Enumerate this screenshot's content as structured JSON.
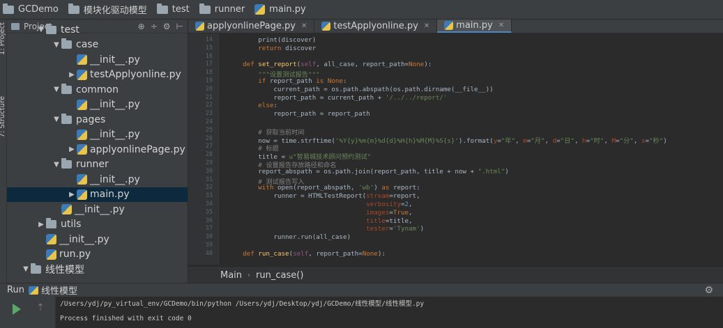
{
  "breadcrumb": [
    {
      "label": "GCDemo",
      "icon": "folder-icon"
    },
    {
      "label": "模块化驱动模型",
      "icon": "folder-icon"
    },
    {
      "label": "test",
      "icon": "folder-icon"
    },
    {
      "label": "runner",
      "icon": "folder-icon"
    },
    {
      "label": "main.py",
      "icon": "python-file-icon"
    }
  ],
  "side_strip": {
    "project": "1: Project",
    "structure": "7: Structure"
  },
  "project": {
    "title": "Project",
    "tools": [
      "⊕",
      "÷",
      "⚙",
      "⊢"
    ],
    "tree": [
      {
        "label": "test",
        "type": "folder",
        "arrow": "▼",
        "indent": 0
      },
      {
        "label": "case",
        "type": "folder",
        "arrow": "▼",
        "indent": 1
      },
      {
        "label": "__init__.py",
        "type": "py",
        "arrow": "",
        "indent": 2
      },
      {
        "label": "testApplyonline.py",
        "type": "py",
        "arrow": "▶",
        "indent": 2
      },
      {
        "label": "common",
        "type": "folder",
        "arrow": "▼",
        "indent": 1
      },
      {
        "label": "__init__.py",
        "type": "py",
        "arrow": "",
        "indent": 2
      },
      {
        "label": "pages",
        "type": "folder",
        "arrow": "▼",
        "indent": 1
      },
      {
        "label": "__init__.py",
        "type": "py",
        "arrow": "",
        "indent": 2
      },
      {
        "label": "applyonlinePage.py",
        "type": "py",
        "arrow": "▶",
        "indent": 2
      },
      {
        "label": "runner",
        "type": "folder",
        "arrow": "▼",
        "indent": 1
      },
      {
        "label": "__init__.py",
        "type": "py",
        "arrow": "",
        "indent": 2
      },
      {
        "label": "main.py",
        "type": "py",
        "arrow": "▶",
        "indent": 2,
        "selected": true
      },
      {
        "label": "__init__.py",
        "type": "py",
        "arrow": "",
        "indent": 1
      },
      {
        "label": "utils",
        "type": "folder",
        "arrow": "▶",
        "indent": 0
      },
      {
        "label": "__init__.py",
        "type": "py",
        "arrow": "",
        "indent": 0
      },
      {
        "label": "run.py",
        "type": "py",
        "arrow": "",
        "indent": 0
      },
      {
        "label": "线性模型",
        "type": "folder",
        "arrow": "▼",
        "indent": -1
      }
    ]
  },
  "tabs": [
    {
      "label": "applyonlinePage.py",
      "active": false
    },
    {
      "label": "testApplyonline.py",
      "active": false
    },
    {
      "label": "main.py",
      "active": true
    }
  ],
  "editor": {
    "lines": [
      {
        "n": "14",
        "html": "        print(discover)"
      },
      {
        "n": "15",
        "html": "        <span class='kw'>return</span> discover"
      },
      {
        "n": "16",
        "html": ""
      },
      {
        "n": "17",
        "html": "    <span class='kw'>def</span> <span class='fn'>set_report</span>(<span class='slf'>self</span>, all_case, report_path=<span class='kw'>None</span>):"
      },
      {
        "n": "18",
        "html": "        <span class='str'>\"\"\"设置测试报告\"\"\"</span>"
      },
      {
        "n": "19",
        "html": "        <span class='kw'>if</span> report_path <span class='kw'>is None</span>:"
      },
      {
        "n": "20",
        "html": "            current_path = os.path.abspath(os.path.dirname(__file__))"
      },
      {
        "n": "21",
        "html": "            report_path = current_path + <span class='str'>'/../../report/'</span>"
      },
      {
        "n": "22",
        "html": "        <span class='kw'>else</span>:"
      },
      {
        "n": "23",
        "html": "            report_path = report_path"
      },
      {
        "n": "24",
        "html": ""
      },
      {
        "n": "25",
        "html": "        <span class='cm'># 获取当前时间</span>"
      },
      {
        "n": "26",
        "html": "        now = time.strftime(<span class='str'>'%Y{y}%m{m}%d{d}%H{h}%M{M}%S{s}'</span>).format(<span class='prm'>y</span>=<span class='str'>\"年\"</span>, <span class='prm'>m</span>=<span class='str'>\"月\"</span>, <span class='prm'>d</span>=<span class='str'>\"日\"</span>, <span class='prm'>h</span>=<span class='str'>\"时\"</span>, <span class='prm'>M</span>=<span class='str'>\"分\"</span>, <span class='prm'>s</span>=<span class='str'>\"秒\"</span>)"
      },
      {
        "n": "27",
        "html": "        <span class='cm'># 标题</span>"
      },
      {
        "n": "28",
        "html": "        title = <span class='str'>u\"智易城技术顾问预约测试\"</span>"
      },
      {
        "n": "29",
        "html": "        <span class='cm'># 设置报告存放路径和命名</span>"
      },
      {
        "n": "30",
        "html": "        report_abspath = os.path.join(report_path, title + now + <span class='str'>\".html\"</span>)"
      },
      {
        "n": "31",
        "html": "        <span class='cm'># 测试报告写入</span>"
      },
      {
        "n": "32",
        "html": "        <span class='kw'>with</span> open(report_abspath, <span class='str'>'wb'</span>) <span class='kw'>as</span> report:"
      },
      {
        "n": "33",
        "html": "            runner = HTMLTestReport(<span class='prm'>stream</span>=report,"
      },
      {
        "n": "34",
        "html": "                                    <span class='prm'>verbosity</span>=<span class='num'>2</span>,"
      },
      {
        "n": "35",
        "html": "                                    <span class='prm'>images</span>=<span class='kw'>True</span>,"
      },
      {
        "n": "36",
        "html": "                                    <span class='prm'>title</span>=title,"
      },
      {
        "n": "37",
        "html": "                                    <span class='prm'>tester</span>=<span class='str'>'Tynam'</span>)"
      },
      {
        "n": "38",
        "html": "            runner.run(all_case)"
      },
      {
        "n": "39",
        "html": ""
      },
      {
        "n": "40",
        "html": "    <span class='kw'>def</span> <span class='fn'>run_case</span>(<span class='slf'>self</span>, report_path=<span class='kw'>None</span>):"
      }
    ]
  },
  "code_breadcrumb": {
    "first": "Main",
    "second": "run_case()"
  },
  "run": {
    "label": "Run",
    "config": "线性模型",
    "command": "/Users/ydj/py_virtual_env/GCDemo/bin/python /Users/ydj/Desktop/ydj/GCDemo/线性模型/线性模型.py",
    "exit": "Process finished with exit code 0"
  }
}
